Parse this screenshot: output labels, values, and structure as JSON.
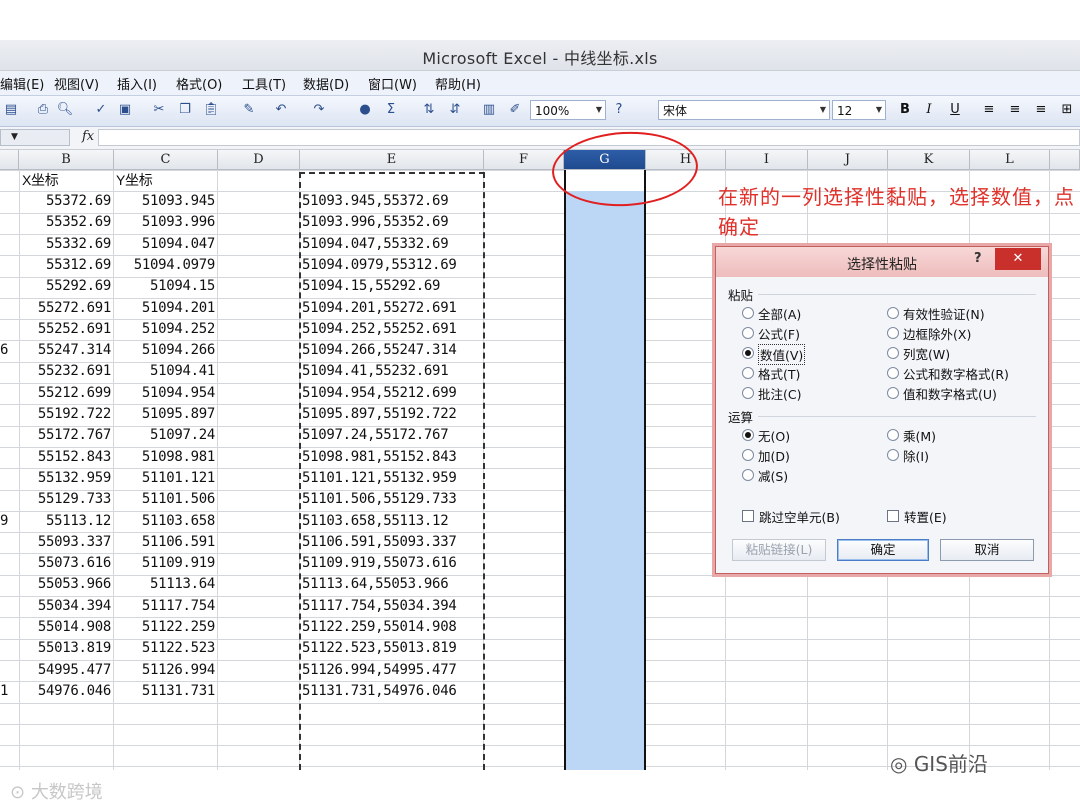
{
  "window": {
    "title": "Microsoft Excel - 中线坐标.xls"
  },
  "menu": [
    "编辑(E)",
    "视图(V)",
    "插入(I)",
    "格式(O)",
    "工具(T)",
    "数据(D)",
    "窗口(W)",
    "帮助(H)"
  ],
  "toolbar": {
    "zoom": "100%",
    "font": "宋体",
    "size": "12",
    "bold": "B",
    "italic": "I",
    "underline": "U"
  },
  "formula_bar": {
    "fx": "fx"
  },
  "columns": [
    "B",
    "C",
    "D",
    "E",
    "F",
    "G",
    "H",
    "I",
    "J",
    "K",
    "L"
  ],
  "selected_column": "G",
  "row_number_fragments": {
    "r8": "6",
    "r16": "9",
    "r24": "1"
  },
  "headers": {
    "B": "X坐标",
    "C": "Y坐标"
  },
  "rows": [
    {
      "B": "55372.69",
      "C": "51093.945",
      "E": "51093.945,55372.69"
    },
    {
      "B": "55352.69",
      "C": "51093.996",
      "E": "51093.996,55352.69"
    },
    {
      "B": "55332.69",
      "C": "51094.047",
      "E": "51094.047,55332.69"
    },
    {
      "B": "55312.69",
      "C": "51094.0979",
      "E": "51094.0979,55312.69"
    },
    {
      "B": "55292.69",
      "C": "51094.15",
      "E": "51094.15,55292.69"
    },
    {
      "B": "55272.691",
      "C": "51094.201",
      "E": "51094.201,55272.691"
    },
    {
      "B": "55252.691",
      "C": "51094.252",
      "E": "51094.252,55252.691"
    },
    {
      "B": "55247.314",
      "C": "51094.266",
      "E": "51094.266,55247.314"
    },
    {
      "B": "55232.691",
      "C": "51094.41",
      "E": "51094.41,55232.691"
    },
    {
      "B": "55212.699",
      "C": "51094.954",
      "E": "51094.954,55212.699"
    },
    {
      "B": "55192.722",
      "C": "51095.897",
      "E": "51095.897,55192.722"
    },
    {
      "B": "55172.767",
      "C": "51097.24",
      "E": "51097.24,55172.767"
    },
    {
      "B": "55152.843",
      "C": "51098.981",
      "E": "51098.981,55152.843"
    },
    {
      "B": "55132.959",
      "C": "51101.121",
      "E": "51101.121,55132.959"
    },
    {
      "B": "55129.733",
      "C": "51101.506",
      "E": "51101.506,55129.733"
    },
    {
      "B": "55113.12",
      "C": "51103.658",
      "E": "51103.658,55113.12"
    },
    {
      "B": "55093.337",
      "C": "51106.591",
      "E": "51106.591,55093.337"
    },
    {
      "B": "55073.616",
      "C": "51109.919",
      "E": "51109.919,55073.616"
    },
    {
      "B": "55053.966",
      "C": "51113.64",
      "E": "51113.64,55053.966"
    },
    {
      "B": "55034.394",
      "C": "51117.754",
      "E": "51117.754,55034.394"
    },
    {
      "B": "55014.908",
      "C": "51122.259",
      "E": "51122.259,55014.908"
    },
    {
      "B": "55013.819",
      "C": "51122.523",
      "E": "51122.523,55013.819"
    },
    {
      "B": "54995.477",
      "C": "51126.994",
      "E": "51126.994,54995.477"
    },
    {
      "B": "54976.046",
      "C": "51131.731",
      "E": "51131.731,54976.046"
    }
  ],
  "annotation": "在新的一列选择性黏贴，选择数值，点确定",
  "dialog": {
    "title": "选择性粘贴",
    "help": "?",
    "close": "✕",
    "paste_group": "粘贴",
    "paste_options": [
      {
        "label": "全部(A)",
        "checked": false
      },
      {
        "label": "公式(F)",
        "checked": false
      },
      {
        "label": "数值(V)",
        "checked": true
      },
      {
        "label": "格式(T)",
        "checked": false
      },
      {
        "label": "批注(C)",
        "checked": false
      },
      {
        "label": "有效性验证(N)",
        "checked": false
      },
      {
        "label": "边框除外(X)",
        "checked": false
      },
      {
        "label": "列宽(W)",
        "checked": false
      },
      {
        "label": "公式和数字格式(R)",
        "checked": false
      },
      {
        "label": "值和数字格式(U)",
        "checked": false
      }
    ],
    "op_group": "运算",
    "op_options": [
      {
        "label": "无(O)",
        "checked": true
      },
      {
        "label": "加(D)",
        "checked": false
      },
      {
        "label": "减(S)",
        "checked": false
      },
      {
        "label": "乘(M)",
        "checked": false
      },
      {
        "label": "除(I)",
        "checked": false
      }
    ],
    "skip_blanks": "跳过空单元(B)",
    "transpose": "转置(E)",
    "paste_link": "粘贴链接(L)",
    "ok": "确定",
    "cancel": "取消"
  },
  "watermarks": {
    "gis": "GIS前沿",
    "bigdata": "大数跨境"
  }
}
